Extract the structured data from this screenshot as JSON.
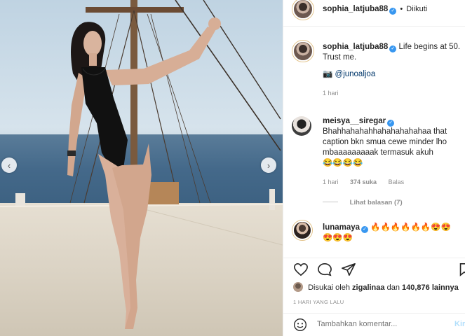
{
  "post": {
    "author": "sophia_latjuba88",
    "follow_status": "Diikuti",
    "verified_mark": "✓",
    "caption": {
      "text": "Life begins at 50. Trust me.",
      "photo_credit_icon": "camera-emoji",
      "photo_credit": "📷 @junoaljoa",
      "time": "1 hari"
    },
    "comments": [
      {
        "user": "meisya__siregar",
        "text": "Bhahhahahahhahahahahahaa that caption bkn smua cewe minder lho mbaaaaaaaaak termasuk akuh",
        "emoji": "😂😂😂😂",
        "time": "1 hari",
        "likes": "374 suka",
        "reply": "Balas",
        "view_replies": "Lihat balasan (7)"
      },
      {
        "user": "lunamaya",
        "emoji_line1": "🔥🔥🔥🔥🔥🔥😍😍",
        "emoji_line2": "😍😍😍"
      }
    ],
    "liked_by": {
      "prefix": "Disukai oleh",
      "user": "zigalinaa",
      "middle": "dan",
      "count": "140,876",
      "suffix": "lainnya"
    },
    "posted_ago": "1 HARI YANG LALU",
    "add_comment": {
      "placeholder": "Tambahkan komentar...",
      "post_label": "Kirim"
    }
  },
  "icons": {
    "prev": "chevron-left-icon",
    "next": "chevron-right-icon",
    "like": "heart-icon",
    "comment": "comment-icon",
    "share": "send-icon",
    "save": "bookmark-icon",
    "emoji": "smiley-icon"
  },
  "colors": {
    "verified": "#3897f0",
    "link": "#00376b",
    "muted": "#8e8e8e",
    "post_button_disabled": "#b2dffc"
  }
}
